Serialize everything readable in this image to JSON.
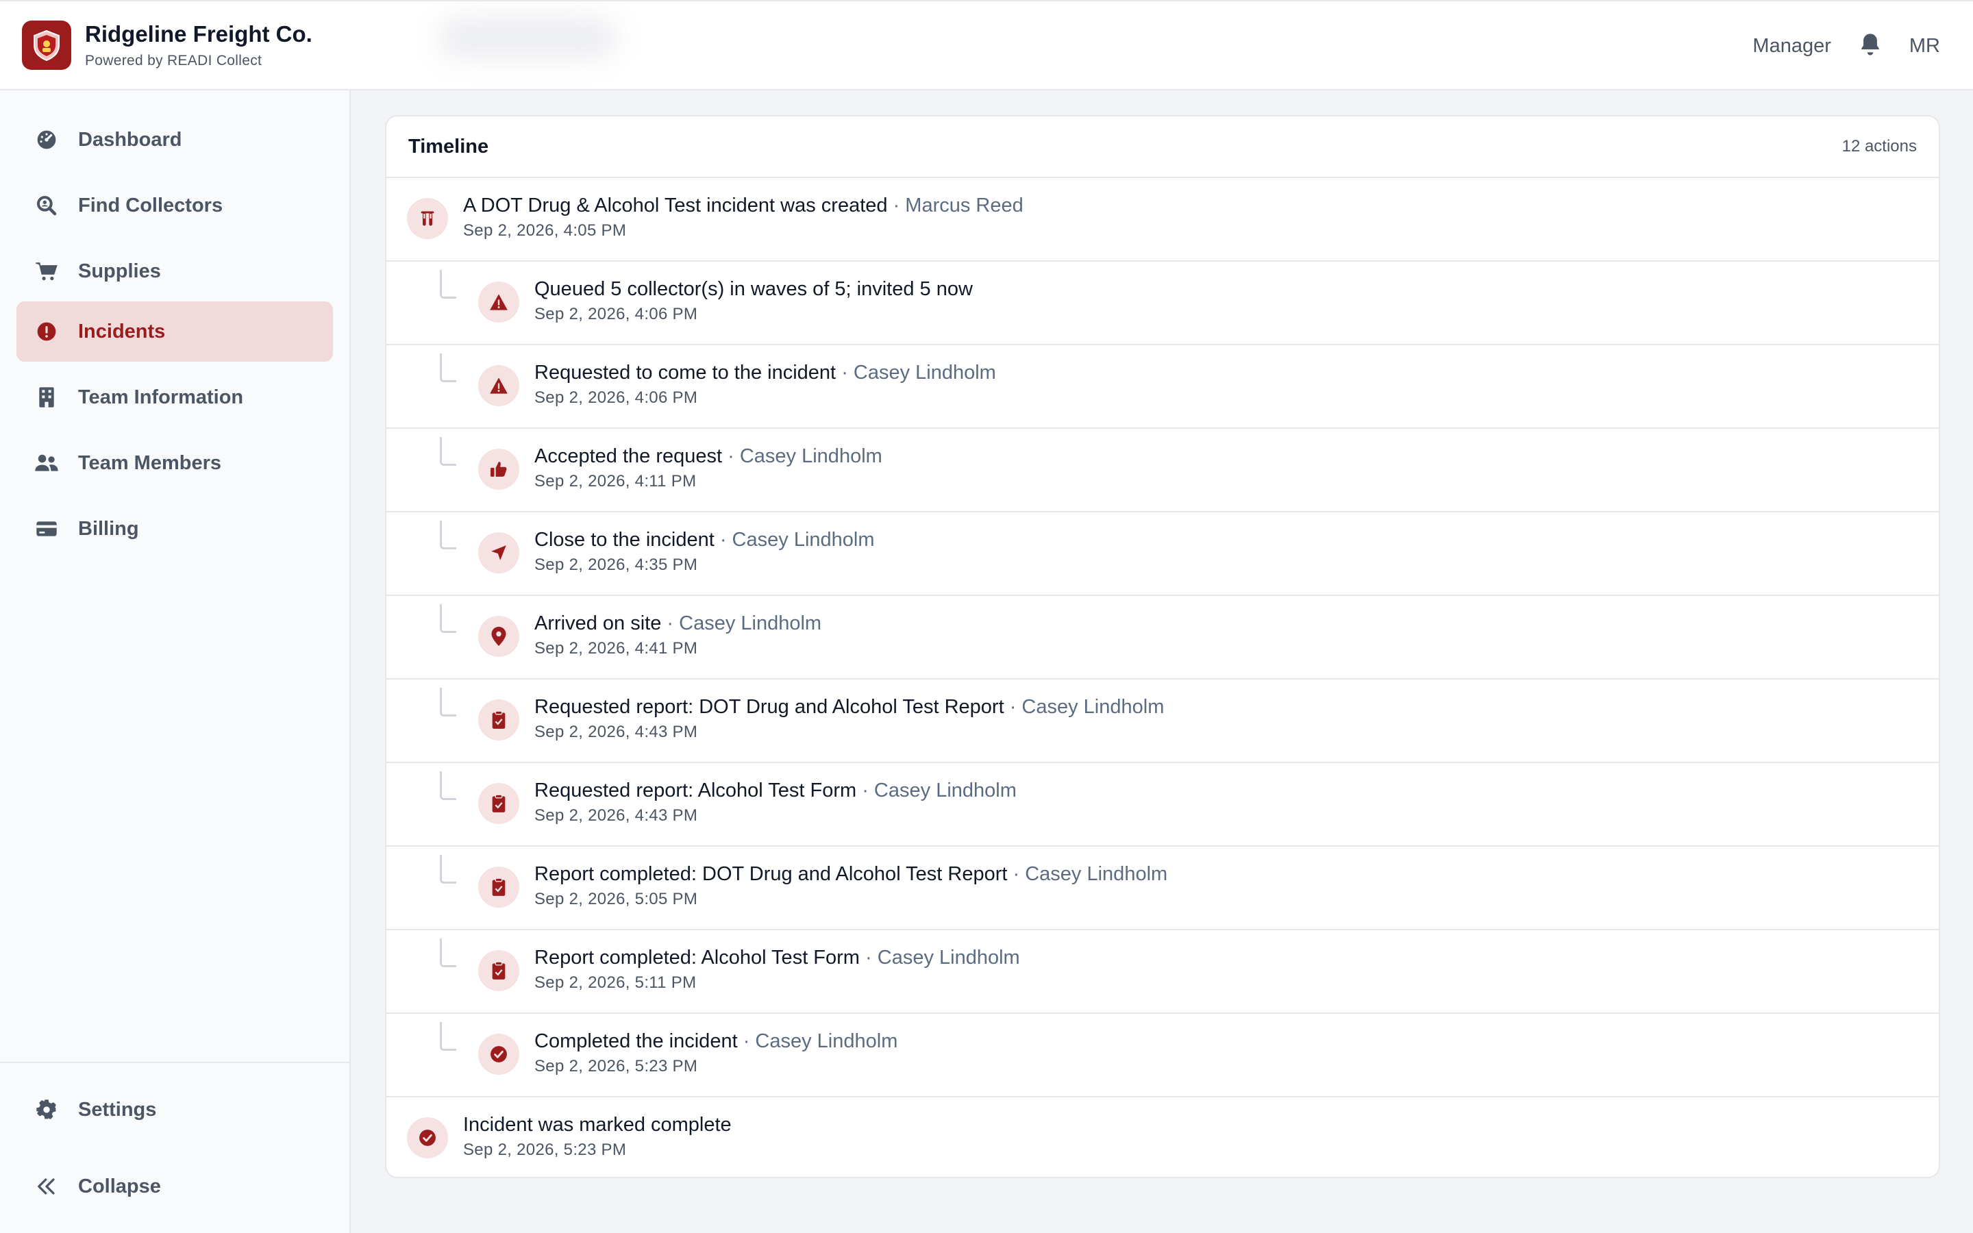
{
  "header": {
    "brand_name": "Ridgeline Freight Co.",
    "brand_sub": "Powered by READI Collect",
    "role": "Manager",
    "initials": "MR",
    "accent_color": "#9b1c1c"
  },
  "sidebar": {
    "items": [
      {
        "label": "Dashboard",
        "icon": "dashboard-gauge-icon"
      },
      {
        "label": "Find Collectors",
        "icon": "search-user-icon"
      },
      {
        "label": "Supplies",
        "icon": "cart-icon"
      },
      {
        "label": "Incidents",
        "icon": "alert-circle-icon",
        "active": true
      },
      {
        "label": "Team Information",
        "icon": "building-icon"
      },
      {
        "label": "Team Members",
        "icon": "users-icon"
      },
      {
        "label": "Billing",
        "icon": "credit-card-icon"
      }
    ],
    "settings_label": "Settings",
    "collapse_label": "Collapse"
  },
  "timeline": {
    "title": "Timeline",
    "count": "12 actions",
    "events": [
      {
        "text": "A DOT Drug & Alcohol Test incident was created",
        "actor": "· Marcus Reed",
        "time": "Sep 2, 2026, 4:05 PM",
        "icon": "flask-icon",
        "level": "top"
      },
      {
        "text": "Queued 5 collector(s) in waves of 5; invited 5 now",
        "actor": "",
        "time": "Sep 2, 2026, 4:06 PM",
        "icon": "warning-icon",
        "level": "child"
      },
      {
        "text": "Requested to come to the incident",
        "actor": "· Casey Lindholm",
        "time": "Sep 2, 2026, 4:06 PM",
        "icon": "warning-icon",
        "level": "child"
      },
      {
        "text": "Accepted the request",
        "actor": "· Casey Lindholm",
        "time": "Sep 2, 2026, 4:11 PM",
        "icon": "thumbs-up-icon",
        "level": "child"
      },
      {
        "text": "Close to the incident",
        "actor": "· Casey Lindholm",
        "time": "Sep 2, 2026, 4:35 PM",
        "icon": "navigation-arrow-icon",
        "level": "child"
      },
      {
        "text": "Arrived on site",
        "actor": "· Casey Lindholm",
        "time": "Sep 2, 2026, 4:41 PM",
        "icon": "map-pin-icon",
        "level": "child"
      },
      {
        "text": "Requested report: DOT Drug and Alcohol Test Report",
        "actor": "· Casey Lindholm",
        "time": "Sep 2, 2026, 4:43 PM",
        "icon": "clipboard-icon",
        "level": "child"
      },
      {
        "text": "Requested report: Alcohol Test Form",
        "actor": "· Casey Lindholm",
        "time": "Sep 2, 2026, 4:43 PM",
        "icon": "clipboard-icon",
        "level": "child"
      },
      {
        "text": "Report completed: DOT Drug and Alcohol Test Report",
        "actor": "· Casey Lindholm",
        "time": "Sep 2, 2026, 5:05 PM",
        "icon": "clipboard-icon",
        "level": "child"
      },
      {
        "text": "Report completed: Alcohol Test Form",
        "actor": "· Casey Lindholm",
        "time": "Sep 2, 2026, 5:11 PM",
        "icon": "clipboard-icon",
        "level": "child"
      },
      {
        "text": "Completed the incident",
        "actor": "· Casey Lindholm",
        "time": "Sep 2, 2026, 5:23 PM",
        "icon": "check-circle-icon",
        "level": "child"
      },
      {
        "text": "Incident was marked complete",
        "actor": "",
        "time": "Sep 2, 2026, 5:23 PM",
        "icon": "check-circle-icon",
        "level": "top"
      }
    ]
  }
}
